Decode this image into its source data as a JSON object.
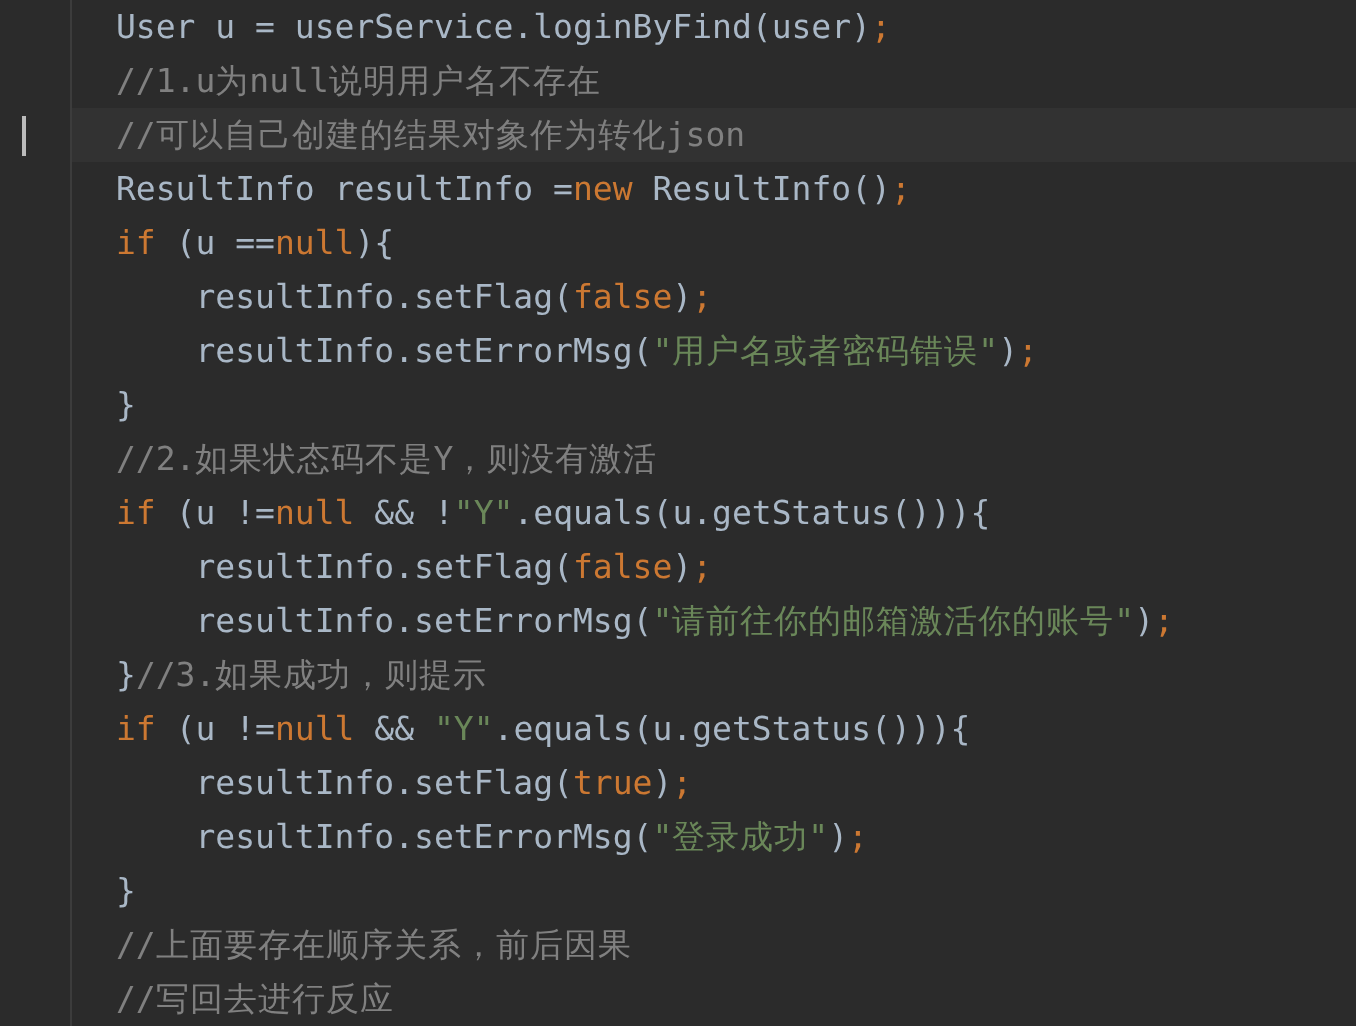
{
  "editor": {
    "lines": [
      {
        "current": false,
        "tokens": [
          {
            "kind": "plain",
            "text": "User u = userService.loginByFind(user)"
          },
          {
            "kind": "keyword",
            "text": ";"
          }
        ]
      },
      {
        "current": false,
        "tokens": [
          {
            "kind": "comment",
            "text": "//1.u为null说明用户名不存在"
          }
        ]
      },
      {
        "current": true,
        "tokens": [
          {
            "kind": "comment",
            "text": "//可以自己创建的结果对象作为转化json"
          }
        ]
      },
      {
        "current": false,
        "tokens": [
          {
            "kind": "plain",
            "text": "ResultInfo resultInfo ="
          },
          {
            "kind": "keyword",
            "text": "new "
          },
          {
            "kind": "plain",
            "text": "ResultInfo()"
          },
          {
            "kind": "keyword",
            "text": ";"
          }
        ]
      },
      {
        "current": false,
        "tokens": [
          {
            "kind": "keyword",
            "text": "if "
          },
          {
            "kind": "plain",
            "text": "(u =="
          },
          {
            "kind": "keyword",
            "text": "null"
          },
          {
            "kind": "plain",
            "text": "){"
          }
        ]
      },
      {
        "current": false,
        "tokens": [
          {
            "kind": "plain",
            "text": "    resultInfo.setFlag("
          },
          {
            "kind": "keyword",
            "text": "false"
          },
          {
            "kind": "plain",
            "text": ")"
          },
          {
            "kind": "keyword",
            "text": ";"
          }
        ]
      },
      {
        "current": false,
        "tokens": [
          {
            "kind": "plain",
            "text": "    resultInfo.setErrorMsg("
          },
          {
            "kind": "string",
            "text": "\"用户名或者密码错误\""
          },
          {
            "kind": "plain",
            "text": ")"
          },
          {
            "kind": "keyword",
            "text": ";"
          }
        ]
      },
      {
        "current": false,
        "tokens": [
          {
            "kind": "plain",
            "text": "}"
          }
        ]
      },
      {
        "current": false,
        "tokens": [
          {
            "kind": "comment",
            "text": "//2.如果状态码不是Y，则没有激活"
          }
        ]
      },
      {
        "current": false,
        "tokens": [
          {
            "kind": "keyword",
            "text": "if "
          },
          {
            "kind": "plain",
            "text": "(u !="
          },
          {
            "kind": "keyword",
            "text": "null "
          },
          {
            "kind": "plain",
            "text": "&& !"
          },
          {
            "kind": "string",
            "text": "\"Y\""
          },
          {
            "kind": "plain",
            "text": ".equals(u.getStatus())){"
          }
        ]
      },
      {
        "current": false,
        "tokens": [
          {
            "kind": "plain",
            "text": "    resultInfo.setFlag("
          },
          {
            "kind": "keyword",
            "text": "false"
          },
          {
            "kind": "plain",
            "text": ")"
          },
          {
            "kind": "keyword",
            "text": ";"
          }
        ]
      },
      {
        "current": false,
        "tokens": [
          {
            "kind": "plain",
            "text": "    resultInfo.setErrorMsg("
          },
          {
            "kind": "string",
            "text": "\"请前往你的邮箱激活你的账号\""
          },
          {
            "kind": "plain",
            "text": ")"
          },
          {
            "kind": "keyword",
            "text": ";"
          }
        ]
      },
      {
        "current": false,
        "tokens": [
          {
            "kind": "plain",
            "text": "}"
          },
          {
            "kind": "comment",
            "text": "//3.如果成功，则提示"
          }
        ]
      },
      {
        "current": false,
        "tokens": [
          {
            "kind": "keyword",
            "text": "if "
          },
          {
            "kind": "plain",
            "text": "(u !="
          },
          {
            "kind": "keyword",
            "text": "null "
          },
          {
            "kind": "plain",
            "text": "&& "
          },
          {
            "kind": "string",
            "text": "\"Y\""
          },
          {
            "kind": "plain",
            "text": ".equals(u.getStatus())){"
          }
        ]
      },
      {
        "current": false,
        "tokens": [
          {
            "kind": "plain",
            "text": "    resultInfo.setFlag("
          },
          {
            "kind": "keyword",
            "text": "true"
          },
          {
            "kind": "plain",
            "text": ")"
          },
          {
            "kind": "keyword",
            "text": ";"
          }
        ]
      },
      {
        "current": false,
        "tokens": [
          {
            "kind": "plain",
            "text": "    resultInfo.setErrorMsg("
          },
          {
            "kind": "string",
            "text": "\"登录成功\""
          },
          {
            "kind": "plain",
            "text": ")"
          },
          {
            "kind": "keyword",
            "text": ";"
          }
        ]
      },
      {
        "current": false,
        "tokens": [
          {
            "kind": "plain",
            "text": "}"
          }
        ]
      },
      {
        "current": false,
        "tokens": [
          {
            "kind": "comment",
            "text": "//上面要存在顺序关系，前后因果"
          }
        ]
      },
      {
        "current": false,
        "tokens": [
          {
            "kind": "comment",
            "text": "//写回去进行反应"
          }
        ]
      }
    ]
  }
}
